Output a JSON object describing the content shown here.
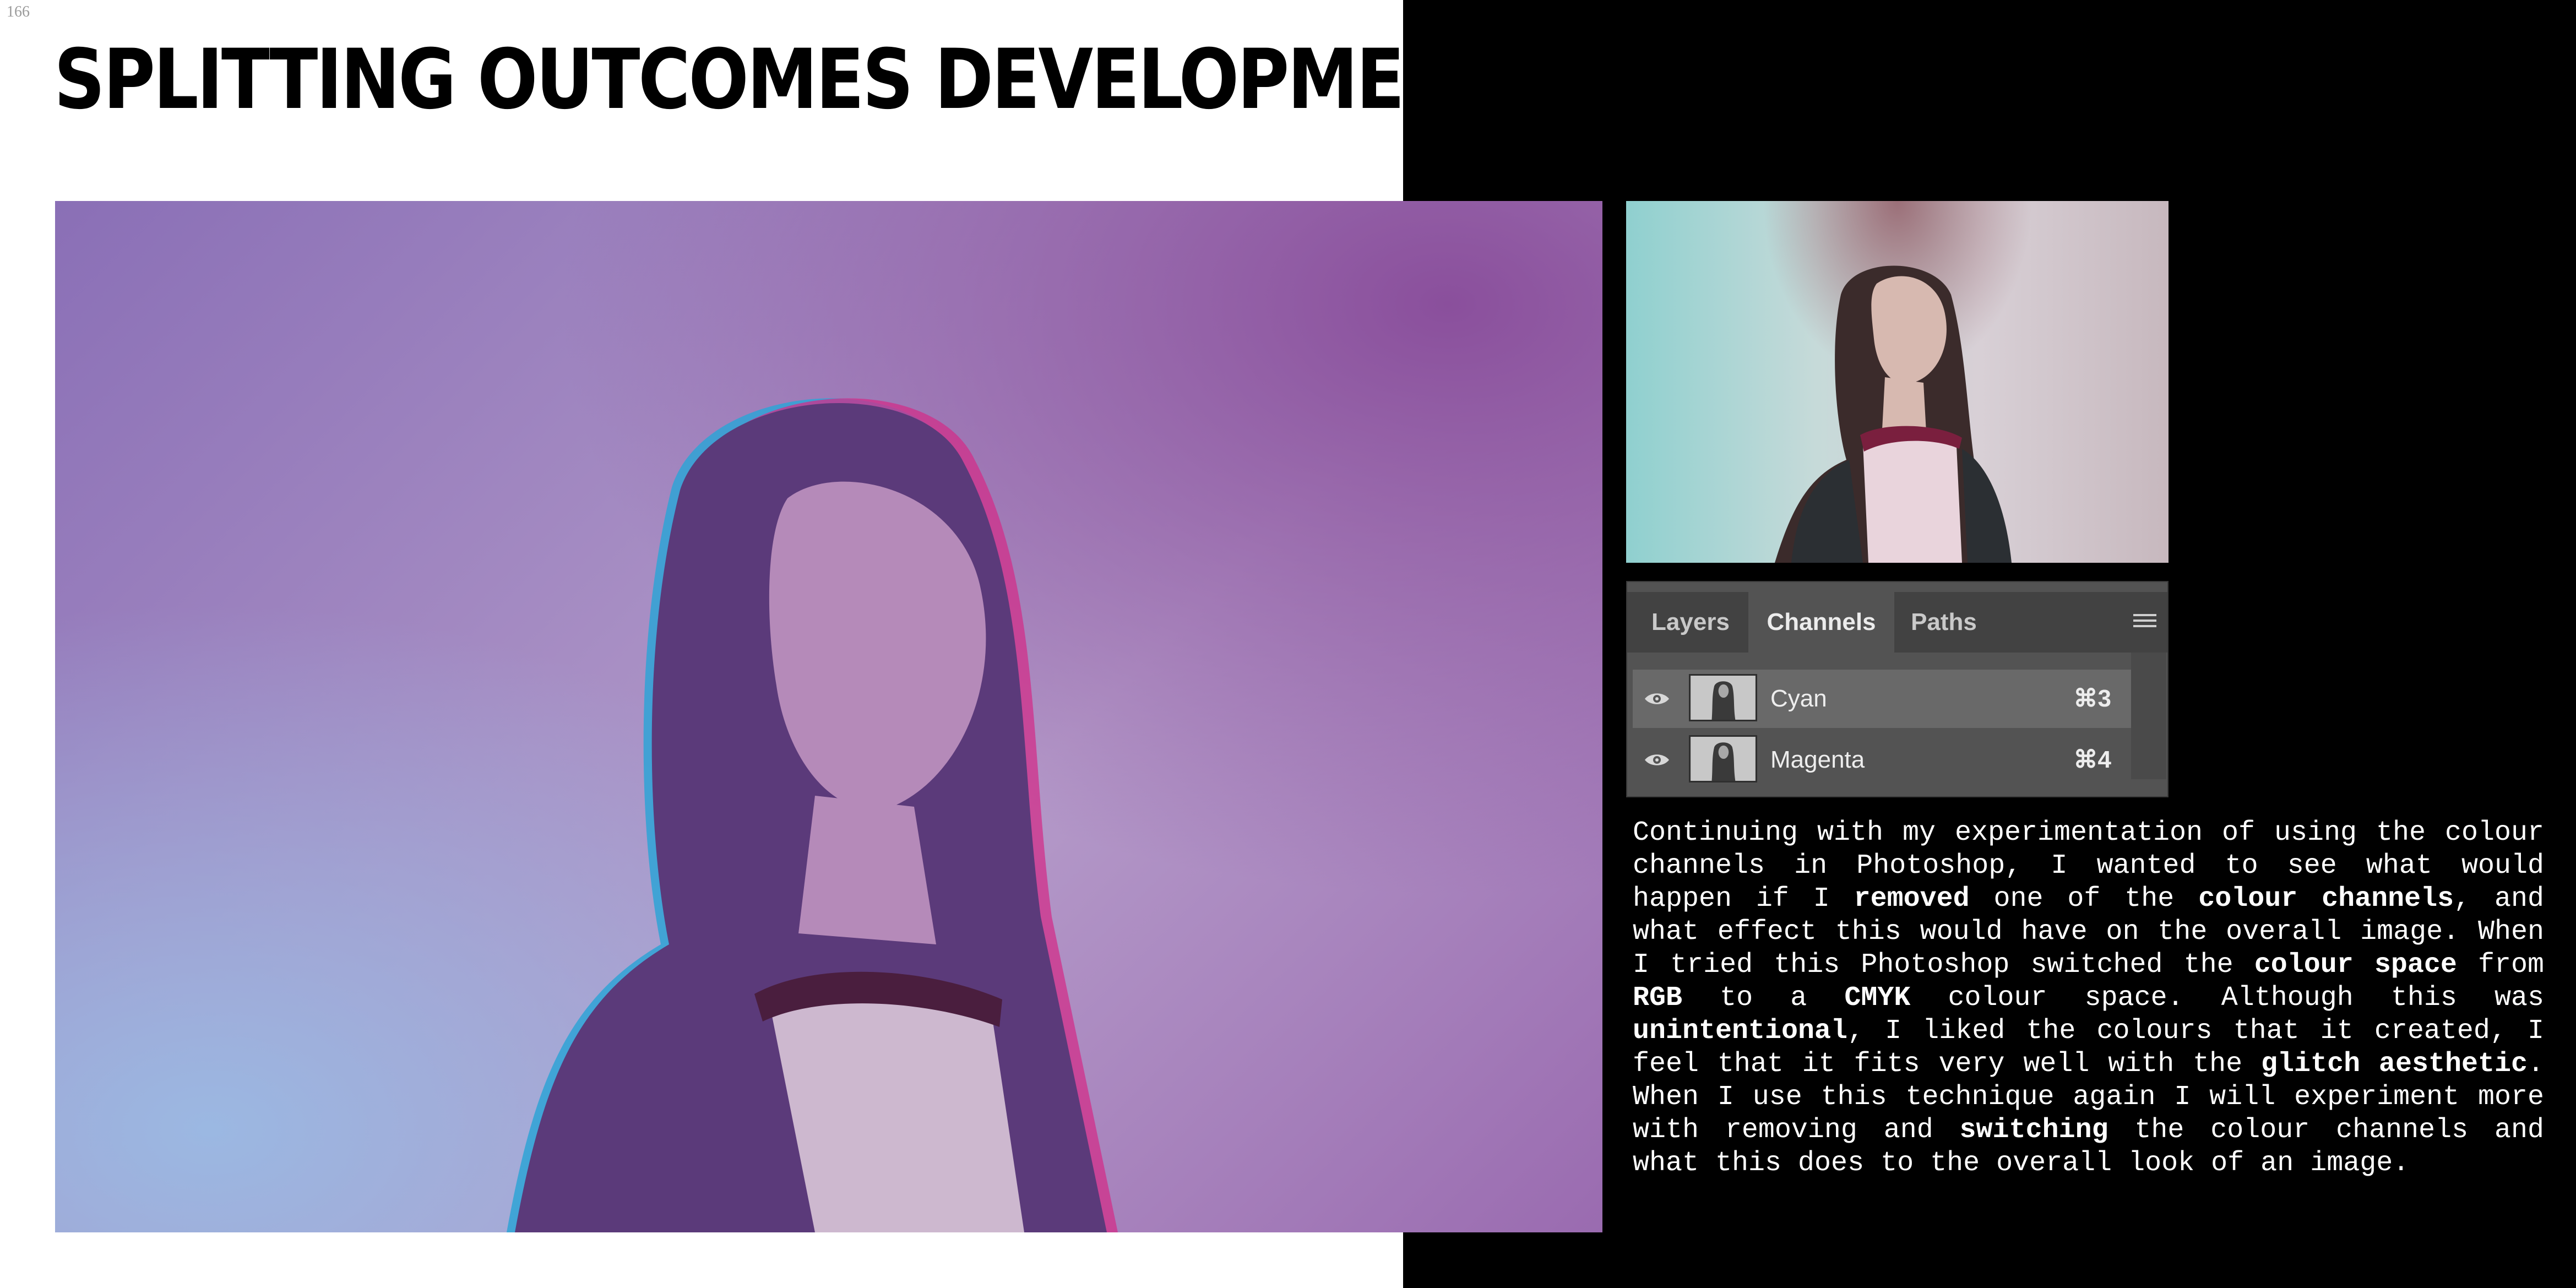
{
  "page": {
    "number": "166",
    "title": "SPLITTING OUTCOMES DEVELOPMENT"
  },
  "colors": {
    "background_left": "#ffffff",
    "background_right": "#000000",
    "title": "#000000",
    "body_text": "#ffffff"
  },
  "images": {
    "main_photo": {
      "subject": "portrait-purple-glitch",
      "tint": "#9a7cc0"
    },
    "thumb_photo": {
      "subject": "portrait-cyan-glitch",
      "tint": "#b9d8d8"
    }
  },
  "channels_panel": {
    "tabs": [
      {
        "label": "Layers",
        "active": false
      },
      {
        "label": "Channels",
        "active": true
      },
      {
        "label": "Paths",
        "active": false
      }
    ],
    "menu_icon": "panel-menu-icon",
    "rows": [
      {
        "name": "Cyan",
        "shortcut": "⌘3",
        "visible": true,
        "selected": true
      },
      {
        "name": "Magenta",
        "shortcut": "⌘4",
        "visible": true,
        "selected": false
      }
    ]
  },
  "description": {
    "segments": [
      {
        "t": "Continuing with my experimentation of using the colour channels in Photoshop, I wanted to see what would happen if I ",
        "b": false
      },
      {
        "t": "removed",
        "b": true
      },
      {
        "t": " one of the ",
        "b": false
      },
      {
        "t": "colour channels",
        "b": true
      },
      {
        "t": ", and what effect this would have on the overall image. When I tried this Photoshop switched the ",
        "b": false
      },
      {
        "t": "colour space",
        "b": true
      },
      {
        "t": " from ",
        "b": false
      },
      {
        "t": "RGB",
        "b": true
      },
      {
        "t": " to a ",
        "b": false
      },
      {
        "t": "CMYK",
        "b": true
      },
      {
        "t": " colour space. Although this was ",
        "b": false
      },
      {
        "t": "unintentional",
        "b": true
      },
      {
        "t": ", I liked the colours that it created, I feel that it fits very well with the ",
        "b": false
      },
      {
        "t": "glitch aesthetic",
        "b": true
      },
      {
        "t": ". When I use this technique again I will experiment more with removing and ",
        "b": false
      },
      {
        "t": "switching",
        "b": true
      },
      {
        "t": " the colour channels and what this does to the overall look of an image.",
        "b": false
      }
    ]
  }
}
